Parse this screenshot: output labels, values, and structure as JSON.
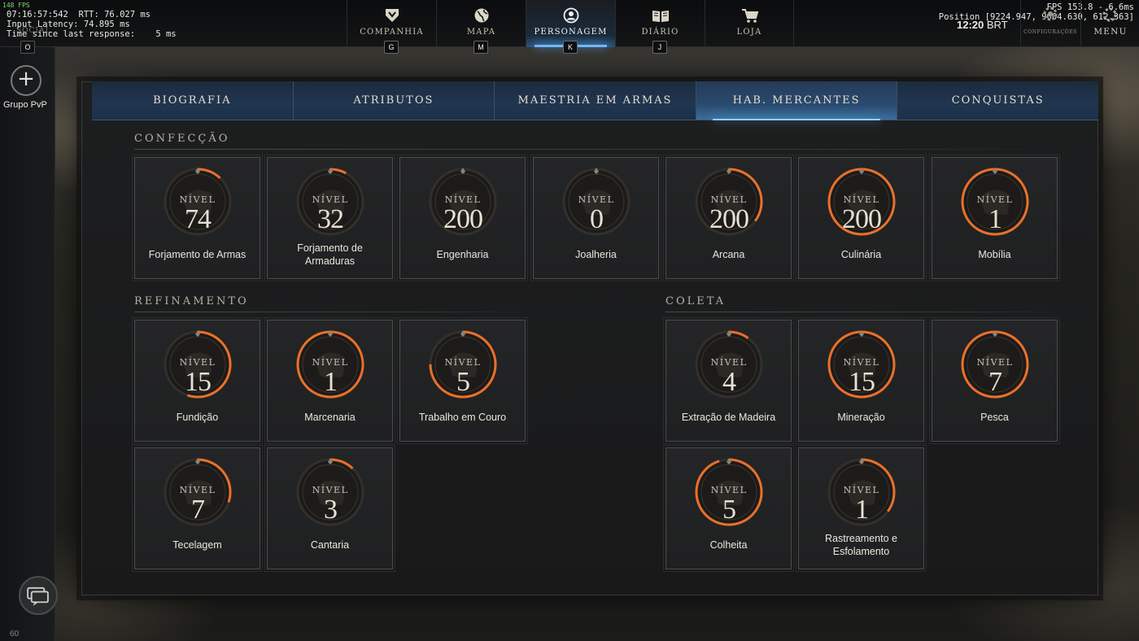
{
  "debug": {
    "fps_small": "148 FPS",
    "line1": "07:16:57:542  RTT: 76.027 ms",
    "line2": "Input Latency: 74.895 ms",
    "line3": "Time since last response:    5 ms",
    "social_label": "SOCIAL",
    "social_key": "O",
    "fps": "FPS 153.8 - 6.6ms",
    "position": "Position [9224.947, 9004.630, 612.363]"
  },
  "clock": {
    "time": "12:20",
    "tz": "BRT"
  },
  "nav": [
    {
      "label": "COMPANHIA",
      "key": "G",
      "icon": "company-shield-icon"
    },
    {
      "label": "MAPA",
      "key": "M",
      "icon": "globe-icon"
    },
    {
      "label": "PERSONAGEM",
      "key": "K",
      "icon": "character-icon"
    },
    {
      "label": "DIÁRIO",
      "key": "J",
      "icon": "book-icon"
    },
    {
      "label": "LOJA",
      "key": "",
      "icon": "cart-icon"
    }
  ],
  "settings_label": "CONFIGURAÇÕES",
  "menu_label": "MENU",
  "left": {
    "pvp_label": "Grupo PvP",
    "chat_count": "60"
  },
  "tabs": [
    "BIOGRAFIA",
    "ATRIBUTOS",
    "MAESTRIA EM ARMAS",
    "HAB. MERCANTES",
    "CONQUISTAS"
  ],
  "active_tab": "HAB. MERCANTES",
  "level_label": "NÍVEL",
  "sections": {
    "confeccao": "CONFECÇÃO",
    "refinamento": "REFINAMENTO",
    "coleta": "COLETA"
  },
  "skills": {
    "confeccao": [
      {
        "name": "Forjamento de Armas",
        "level": "74",
        "progress": 0.12
      },
      {
        "name": "Forjamento de Armaduras",
        "level": "32",
        "progress": 0.08
      },
      {
        "name": "Engenharia",
        "level": "200",
        "progress": 0.0
      },
      {
        "name": "Joalheria",
        "level": "0",
        "progress": 0.0
      },
      {
        "name": "Arcana",
        "level": "200",
        "progress": 0.35
      },
      {
        "name": "Culinária",
        "level": "200",
        "progress": 1.0
      },
      {
        "name": "Mobília",
        "level": "1",
        "progress": 1.0
      }
    ],
    "refinamento": [
      {
        "name": "Fundição",
        "level": "15",
        "progress": 0.55
      },
      {
        "name": "Marcenaria",
        "level": "1",
        "progress": 1.0
      },
      {
        "name": "Trabalho em Couro",
        "level": "5",
        "progress": 0.75
      },
      {
        "name": "Tecelagem",
        "level": "7",
        "progress": 0.3
      },
      {
        "name": "Cantaria",
        "level": "3",
        "progress": 0.12
      }
    ],
    "coleta": [
      {
        "name": "Extração de Madeira",
        "level": "4",
        "progress": 0.1
      },
      {
        "name": "Mineração",
        "level": "15",
        "progress": 1.0
      },
      {
        "name": "Pesca",
        "level": "7",
        "progress": 1.0
      },
      {
        "name": "Colheita",
        "level": "5",
        "progress": 0.95
      },
      {
        "name": "Rastreamento e Esfolamento",
        "level": "1",
        "progress": 0.35
      }
    ]
  },
  "colors": {
    "accent_orange": "#e9702a",
    "tab_blue": "#2a4a6e",
    "ring_dark": "#2e2b27"
  }
}
